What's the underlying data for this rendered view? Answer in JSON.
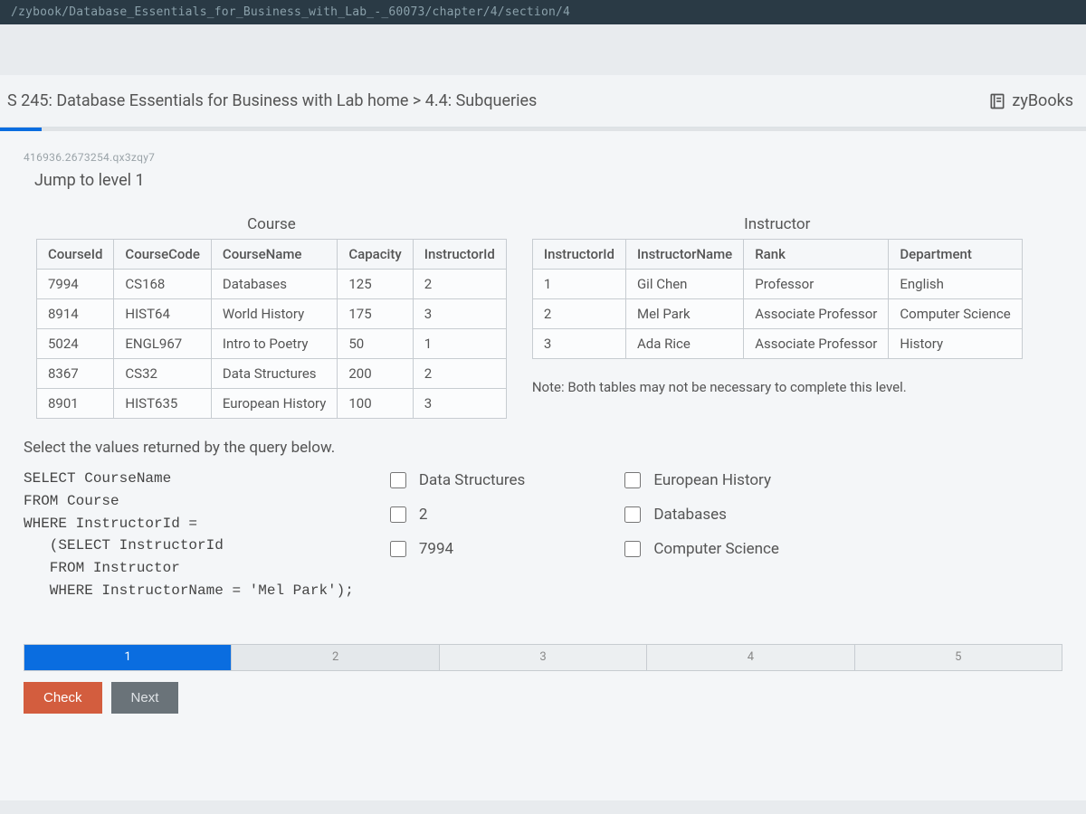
{
  "url_fragment": "/zybook/Database_Essentials_for_Business_with_Lab_-_60073/chapter/4/section/4",
  "breadcrumb": "S 245: Database Essentials for Business with Lab home > 4.4: Subqueries",
  "brand": "zyBooks",
  "meta_id": "416936.2673254.qx3zqy7",
  "jump_label": "Jump to level 1",
  "tables": {
    "course": {
      "title": "Course",
      "headers": [
        "CourseId",
        "CourseCode",
        "CourseName",
        "Capacity",
        "InstructorId"
      ],
      "rows": [
        [
          "7994",
          "CS168",
          "Databases",
          "125",
          "2"
        ],
        [
          "8914",
          "HIST64",
          "World History",
          "175",
          "3"
        ],
        [
          "5024",
          "ENGL967",
          "Intro to Poetry",
          "50",
          "1"
        ],
        [
          "8367",
          "CS32",
          "Data Structures",
          "200",
          "2"
        ],
        [
          "8901",
          "HIST635",
          "European History",
          "100",
          "3"
        ]
      ]
    },
    "instructor": {
      "title": "Instructor",
      "headers": [
        "InstructorId",
        "InstructorName",
        "Rank",
        "Department"
      ],
      "rows": [
        [
          "1",
          "Gil Chen",
          "Professor",
          "English"
        ],
        [
          "2",
          "Mel Park",
          "Associate Professor",
          "Computer Science"
        ],
        [
          "3",
          "Ada Rice",
          "Associate Professor",
          "History"
        ]
      ]
    }
  },
  "note": "Note: Both tables may not be necessary to complete this level.",
  "prompt": "Select the values returned by the query below.",
  "sql": "SELECT CourseName\nFROM Course\nWHERE InstructorId =\n   (SELECT InstructorId\n   FROM Instructor\n   WHERE InstructorName = 'Mel Park');",
  "answers": [
    "Data Structures",
    "European History",
    "2",
    "Databases",
    "7994",
    "Computer Science"
  ],
  "steps": [
    "1",
    "2",
    "3",
    "4",
    "5"
  ],
  "buttons": {
    "check": "Check",
    "next": "Next"
  }
}
